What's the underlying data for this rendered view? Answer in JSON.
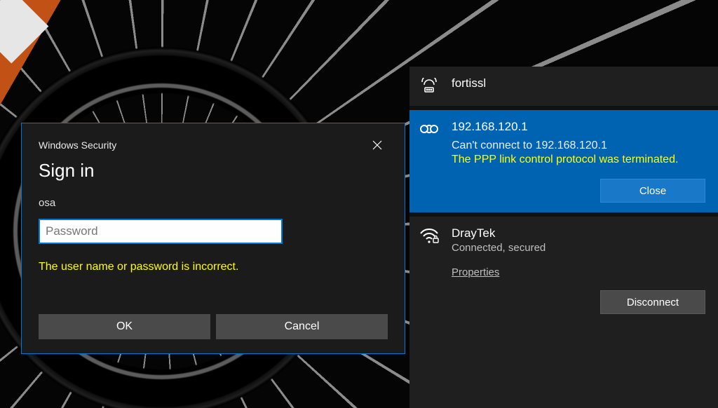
{
  "dialog": {
    "title": "Windows Security",
    "heading": "Sign in",
    "username": "osa",
    "password_placeholder": "Password",
    "password_value": "",
    "error": "The user name or password is incorrect.",
    "ok_label": "OK",
    "cancel_label": "Cancel"
  },
  "network": {
    "items": [
      {
        "icon": "modem-icon",
        "name": "fortissl"
      },
      {
        "icon": "vpn-chain-icon",
        "name": "192.168.120.1",
        "message": "Can't connect to 192.168.120.1",
        "error": "The PPP link control protocol was terminated.",
        "close_label": "Close"
      },
      {
        "icon": "wifi-secure-icon",
        "name": "DrayTek",
        "state": "Connected, secured",
        "properties_label": "Properties",
        "disconnect_label": "Disconnect"
      }
    ]
  }
}
